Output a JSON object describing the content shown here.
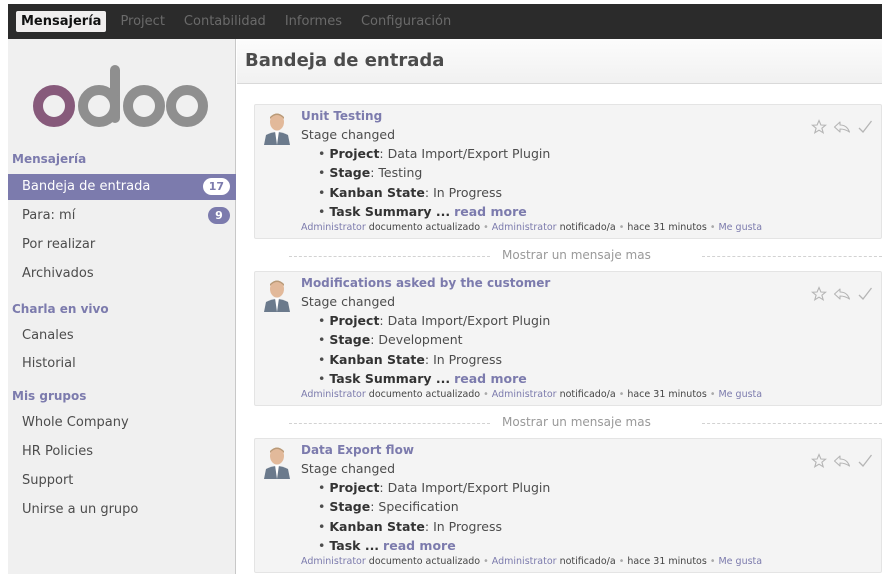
{
  "topbar": {
    "items": [
      {
        "label": "Mensajería",
        "active": true
      },
      {
        "label": "Project",
        "active": false
      },
      {
        "label": "Contabilidad",
        "active": false
      },
      {
        "label": "Informes",
        "active": false
      },
      {
        "label": "Configuración",
        "active": false
      }
    ]
  },
  "sidebar": {
    "logo_text": "odoo",
    "sections": [
      {
        "title": "Mensajería"
      },
      {
        "title": "Charla en vivo"
      },
      {
        "title": "Mis grupos"
      }
    ],
    "items": [
      {
        "label": "Bandeja de entrada",
        "badge": "17"
      },
      {
        "label": "Para: mí",
        "badge": "9"
      },
      {
        "label": "Por realizar"
      },
      {
        "label": "Archivados"
      },
      {
        "label": "Canales"
      },
      {
        "label": "Historial"
      },
      {
        "label": "Whole Company"
      },
      {
        "label": "HR Policies"
      },
      {
        "label": "Support"
      },
      {
        "label": "Unirse a un grupo"
      }
    ]
  },
  "main": {
    "title": "Bandeja de entrada",
    "show_more": "Mostrar un mensaje mas",
    "messages": [
      {
        "title": "Unit Testing",
        "subtitle": "Stage changed",
        "fields": [
          {
            "name": "Project",
            "value": ": Data Import/Export Plugin"
          },
          {
            "name": "Stage",
            "value": ": Testing"
          },
          {
            "name": "Kanban State",
            "value": ": In Progress"
          },
          {
            "name": "Task Summary ...",
            "value": ""
          }
        ],
        "read_more": "read more",
        "footer": {
          "author": "Administrator",
          "action": "documento actualizado",
          "notified": "Administrator",
          "notified_label": "notificado/a",
          "time": "hace 31 minutos",
          "like": "Me gusta"
        }
      },
      {
        "title": "Modifications asked by the customer",
        "subtitle": "Stage changed",
        "fields": [
          {
            "name": "Project",
            "value": ": Data Import/Export Plugin"
          },
          {
            "name": "Stage",
            "value": ": Development"
          },
          {
            "name": "Kanban State",
            "value": ": In Progress"
          },
          {
            "name": "Task Summary ...",
            "value": ""
          }
        ],
        "read_more": "read more",
        "footer": {
          "author": "Administrator",
          "action": "documento actualizado",
          "notified": "Administrator",
          "notified_label": "notificado/a",
          "time": "hace 31 minutos",
          "like": "Me gusta"
        }
      },
      {
        "title": "Data Export flow",
        "subtitle": "Stage changed",
        "fields": [
          {
            "name": "Project",
            "value": ": Data Import/Export Plugin"
          },
          {
            "name": "Stage",
            "value": ": Specification"
          },
          {
            "name": "Kanban State",
            "value": ": In Progress"
          },
          {
            "name": "Task ...",
            "value": ""
          }
        ],
        "read_more": "read more",
        "footer": {
          "author": "Administrator",
          "action": "documento actualizado",
          "notified": "Administrator",
          "notified_label": "notificado/a",
          "time": "hace 31 minutos",
          "like": "Me gusta"
        }
      }
    ]
  },
  "icons": {
    "star": "star-icon",
    "reply": "reply-icon",
    "done": "checkmark-icon"
  },
  "colors": {
    "accent": "#7c7bad",
    "topbar": "#2b2b2b",
    "sidebar": "#f0f0f0",
    "logo_o": "#875a7b",
    "logo_doo": "#8f8f8f"
  }
}
